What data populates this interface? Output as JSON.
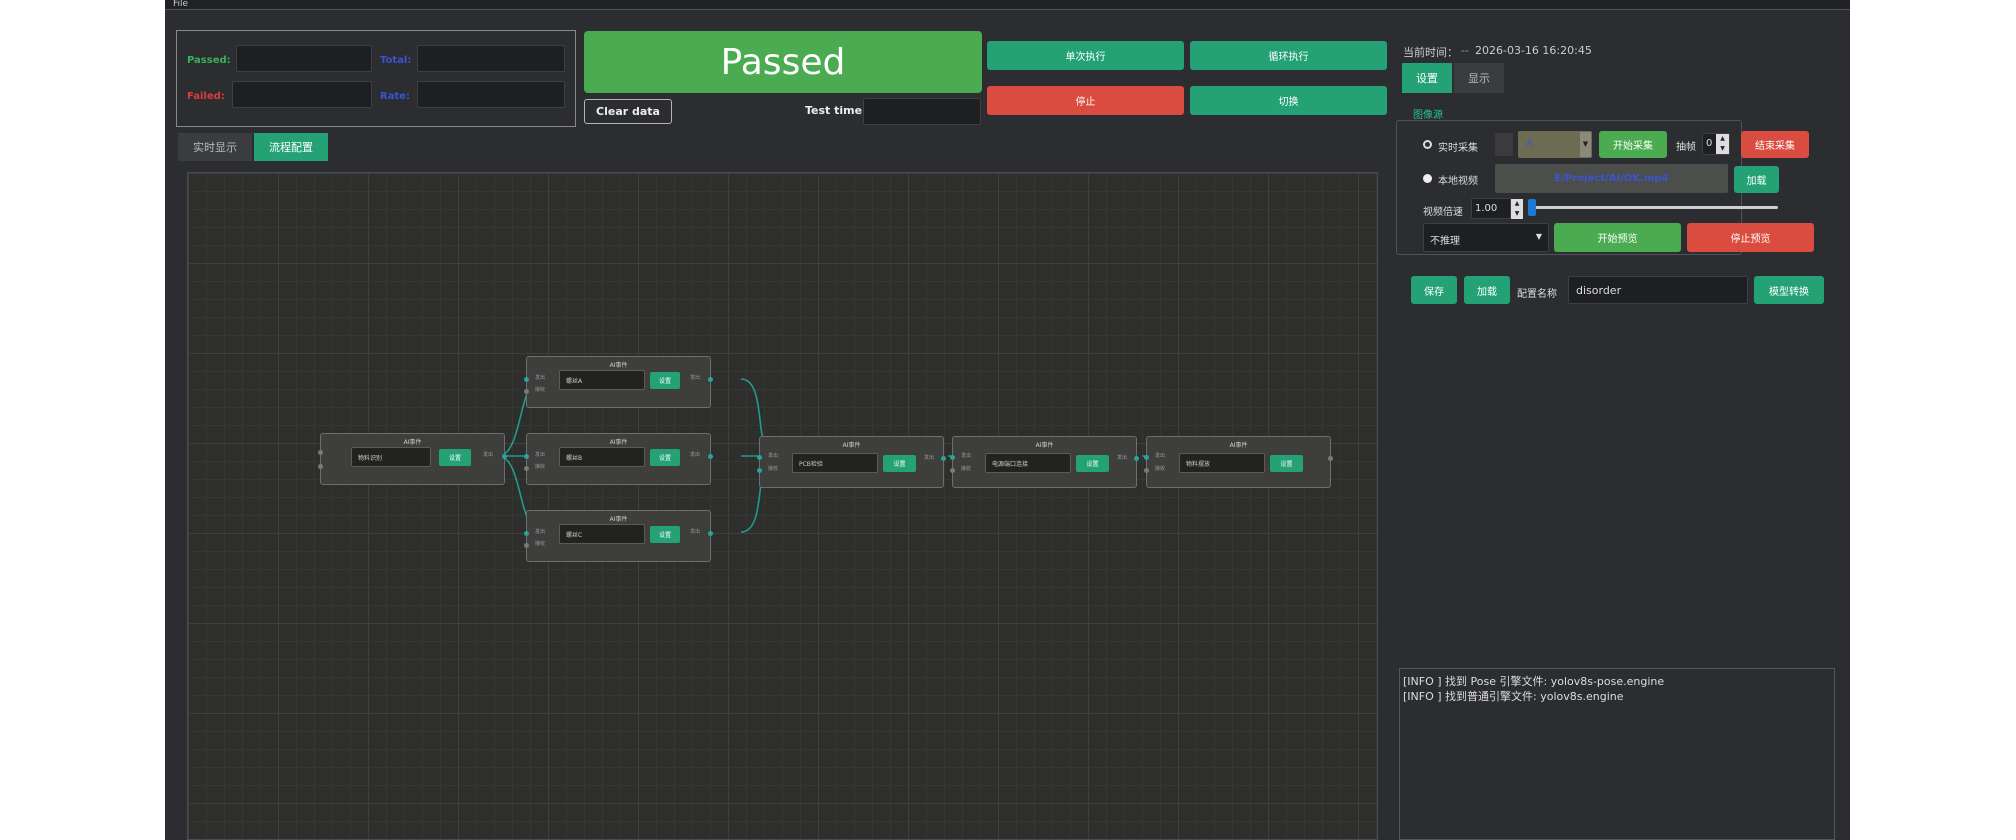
{
  "menu": {
    "file": "File"
  },
  "stats": {
    "passed_label": "Passed:",
    "failed_label": "Failed:",
    "total_label": "Total:",
    "rate_label": "Rate:",
    "passed_value": "",
    "failed_value": "",
    "total_value": "",
    "rate_value": "",
    "colors": {
      "passed": "#3bb05a",
      "failed": "#e03a3a",
      "blue": "#3a55d0"
    }
  },
  "result": {
    "status": "Passed"
  },
  "controls": {
    "clear_data": "Clear data",
    "test_time_label": "Test time:",
    "test_time_value": "",
    "single_run": "单次执行",
    "loop_run": "循环执行",
    "stop": "停止",
    "switch": "切换"
  },
  "left_tabs": {
    "realtime": "实时显示",
    "flow": "流程配置"
  },
  "flow_nodes": [
    {
      "title": "AI事件",
      "field": "物料识别",
      "button": "设置",
      "out_label": "发出"
    },
    {
      "title": "AI事件",
      "field": "螺丝A",
      "button": "设置",
      "in1": "发出",
      "in2": "接收",
      "out_label": "发出"
    },
    {
      "title": "AI事件",
      "field": "螺丝B",
      "button": "设置",
      "in1": "发出",
      "in2": "接收",
      "out_label": "发出"
    },
    {
      "title": "AI事件",
      "field": "螺丝C",
      "button": "设置",
      "in1": "发出",
      "in2": "接收",
      "out_label": "发出"
    },
    {
      "title": "AI事件",
      "field": "PCB检验",
      "button": "设置",
      "in1": "发出",
      "in2": "接收",
      "out_label": "发出"
    },
    {
      "title": "AI事件",
      "field": "电源端口连接",
      "button": "设置",
      "in1": "发出",
      "in2": "接收",
      "out_label": "发出"
    },
    {
      "title": "AI事件",
      "field": "物料摆放",
      "button": "设置",
      "in1": "发出",
      "in2": "接收"
    }
  ],
  "right": {
    "time_label": "当前时间：",
    "time_value": "2026-03-16 16:20:45",
    "tabs": {
      "settings": "设置",
      "display": "显示"
    },
    "source_group": "图像源",
    "live_capture": "实时采集",
    "camera_value": "A",
    "start_capture": "开始采集",
    "frame_label": "抽帧",
    "frame_value": "0",
    "end_capture": "结束采集",
    "local_video": "本地视频",
    "video_path": "E/Project/AI/OK.mp4",
    "load": "加载",
    "speed_label": "视频倍速",
    "speed_value": "1.00",
    "speed_fraction": 0.0,
    "infer_mode": "不推理",
    "start_preview": "开始预览",
    "stop_preview": "停止预览",
    "save": "保存",
    "load2": "加载",
    "config_label": "配置名称",
    "config_value": "disorder",
    "model_convert": "模型转换"
  },
  "log": [
    "[INFO ] 找到 Pose 引擎文件: yolov8s-pose.engine",
    "[INFO ] 找到普通引擎文件: yolov8s.engine"
  ]
}
